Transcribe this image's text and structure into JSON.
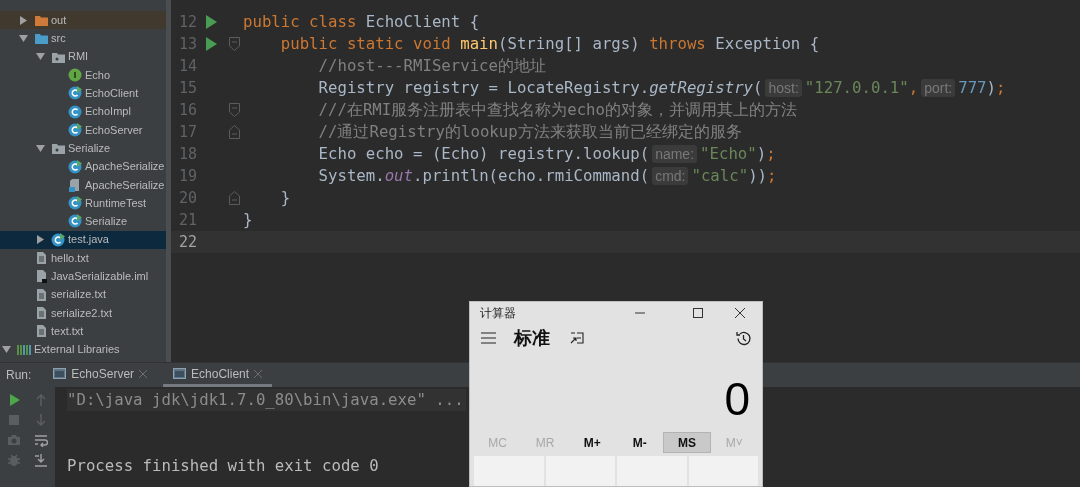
{
  "project_tree": {
    "items": [
      {
        "name": "out",
        "kind": "folder_excluded",
        "expanded": false,
        "selected": false
      },
      {
        "name": "src",
        "kind": "source_folder",
        "expanded": true,
        "selected": false,
        "children": [
          {
            "name": "RMI",
            "kind": "package",
            "expanded": true,
            "selected": false,
            "children": [
              {
                "name": "Echo",
                "kind": "interface",
                "selected": false
              },
              {
                "name": "EchoClient",
                "kind": "class_main",
                "selected": false
              },
              {
                "name": "EchoImpl",
                "kind": "class",
                "selected": false
              },
              {
                "name": "EchoServer",
                "kind": "class_main",
                "selected": false
              }
            ]
          },
          {
            "name": "Serialize",
            "kind": "package",
            "expanded": true,
            "selected": false,
            "children": [
              {
                "name": "ApacheSerialize",
                "kind": "class_main",
                "selected": false
              },
              {
                "name": "ApacheSerialize",
                "kind": "data_file",
                "selected": false
              },
              {
                "name": "RuntimeTest",
                "kind": "class_main",
                "selected": false
              },
              {
                "name": "Serialize",
                "kind": "class_main",
                "selected": false
              }
            ]
          },
          {
            "name": "test.java",
            "kind": "class_main",
            "expanded": false,
            "selected": true
          }
        ]
      },
      {
        "name": "hello.txt",
        "kind": "text_file",
        "selected": false
      },
      {
        "name": "JavaSerializable.iml",
        "kind": "module_file",
        "selected": false
      },
      {
        "name": "serialize.txt",
        "kind": "text_file",
        "selected": false
      },
      {
        "name": "serialize2.txt",
        "kind": "text_file",
        "selected": false
      },
      {
        "name": "text.txt",
        "kind": "text_file",
        "selected": false
      }
    ],
    "external_libraries": {
      "name": "External Libraries",
      "expanded": true
    }
  },
  "editor": {
    "lines": [
      {
        "number": "12",
        "run": true,
        "segments": [
          {
            "kind": "code",
            "tokens": [
              {
                "text": "public class ",
                "kind": "keyword"
              },
              {
                "text": "EchoClient {",
                "kind": "plain"
              }
            ]
          }
        ]
      },
      {
        "number": "13",
        "run": true,
        "fold_start": true,
        "segments": [
          {
            "kind": "code",
            "tokens": [
              {
                "text": "    public static void ",
                "kind": "keyword"
              },
              {
                "text": "main",
                "kind": "declaration"
              },
              {
                "text": "(String[] args) ",
                "kind": "plain"
              },
              {
                "text": "throws ",
                "kind": "keyword"
              },
              {
                "text": "Exception {",
                "kind": "plain"
              }
            ]
          }
        ]
      },
      {
        "number": "14",
        "segments": [
          {
            "kind": "code",
            "tokens": [
              {
                "text": "        //host---RMIService的地址",
                "kind": "comment"
              }
            ]
          }
        ]
      },
      {
        "number": "15",
        "segments": [
          {
            "kind": "code",
            "tokens": [
              {
                "text": "        Registry registry = LocateRegistry.",
                "kind": "plain"
              },
              {
                "text": "getRegistry",
                "kind": "static_call"
              },
              {
                "text": "(",
                "kind": "plain"
              }
            ]
          },
          {
            "kind": "hint",
            "text": "host:"
          },
          {
            "kind": "code",
            "tokens": [
              {
                "text": "\"127.0.0.1\"",
                "kind": "string"
              },
              {
                "text": ",",
                "kind": "keyword"
              }
            ]
          },
          {
            "kind": "hint",
            "text": "port:"
          },
          {
            "kind": "code",
            "tokens": [
              {
                "text": "777",
                "kind": "number"
              },
              {
                "text": ")",
                "kind": "plain"
              },
              {
                "text": ";",
                "kind": "keyword"
              }
            ]
          }
        ]
      },
      {
        "number": "16",
        "fold_start": true,
        "segments": [
          {
            "kind": "code",
            "tokens": [
              {
                "text": "        ///在RMI服务注册表中查找名称为echo的对象，并调用其上的方法",
                "kind": "comment"
              }
            ]
          }
        ]
      },
      {
        "number": "17",
        "fold_end": true,
        "segments": [
          {
            "kind": "code",
            "tokens": [
              {
                "text": "        //通过Registry的lookup方法来获取当前已经绑定的服务",
                "kind": "comment"
              }
            ]
          }
        ]
      },
      {
        "number": "18",
        "segments": [
          {
            "kind": "code",
            "tokens": [
              {
                "text": "        Echo echo = (Echo) registry.lookup(",
                "kind": "plain"
              }
            ]
          },
          {
            "kind": "hint",
            "text": "name:"
          },
          {
            "kind": "code",
            "tokens": [
              {
                "text": "\"Echo\"",
                "kind": "string"
              },
              {
                "text": ")",
                "kind": "plain"
              },
              {
                "text": ";",
                "kind": "keyword"
              }
            ]
          }
        ]
      },
      {
        "number": "19",
        "segments": [
          {
            "kind": "code",
            "tokens": [
              {
                "text": "        System.",
                "kind": "plain"
              },
              {
                "text": "out",
                "kind": "static_field"
              },
              {
                "text": ".println(echo.rmiCommand(",
                "kind": "plain"
              }
            ]
          },
          {
            "kind": "hint",
            "text": "cmd:"
          },
          {
            "kind": "code",
            "tokens": [
              {
                "text": "\"calc\"",
                "kind": "string"
              },
              {
                "text": "))",
                "kind": "plain"
              },
              {
                "text": ";",
                "kind": "keyword"
              }
            ]
          }
        ]
      },
      {
        "number": "20",
        "fold_end": true,
        "segments": [
          {
            "kind": "code",
            "tokens": [
              {
                "text": "    }",
                "kind": "plain"
              }
            ]
          }
        ]
      },
      {
        "number": "21",
        "segments": [
          {
            "kind": "code",
            "tokens": [
              {
                "text": "}",
                "kind": "plain"
              }
            ]
          }
        ]
      },
      {
        "number": "22",
        "current": true
      }
    ]
  },
  "run_panel": {
    "label": "Run:",
    "tabs": [
      {
        "label": "EchoServer",
        "selected": false
      },
      {
        "label": "EchoClient",
        "selected": true
      }
    ],
    "console": [
      {
        "text": "\"D:\\java jdk\\jdk1.7.0_80\\bin\\java.exe\" ...",
        "kind": "command"
      },
      {
        "text": "Process finished with exit code 0",
        "kind": "output"
      }
    ]
  },
  "calculator": {
    "title": "计算器",
    "mode": "标准",
    "display": "0",
    "memory_buttons": [
      {
        "label": "MC",
        "disabled": true,
        "pressed": false
      },
      {
        "label": "MR",
        "disabled": true,
        "pressed": false
      },
      {
        "label": "M+",
        "disabled": false,
        "pressed": false
      },
      {
        "label": "M-",
        "disabled": false,
        "pressed": false
      },
      {
        "label": "MS",
        "disabled": false,
        "pressed": true
      },
      {
        "label": "M˅",
        "disabled": true,
        "pressed": false
      }
    ]
  }
}
